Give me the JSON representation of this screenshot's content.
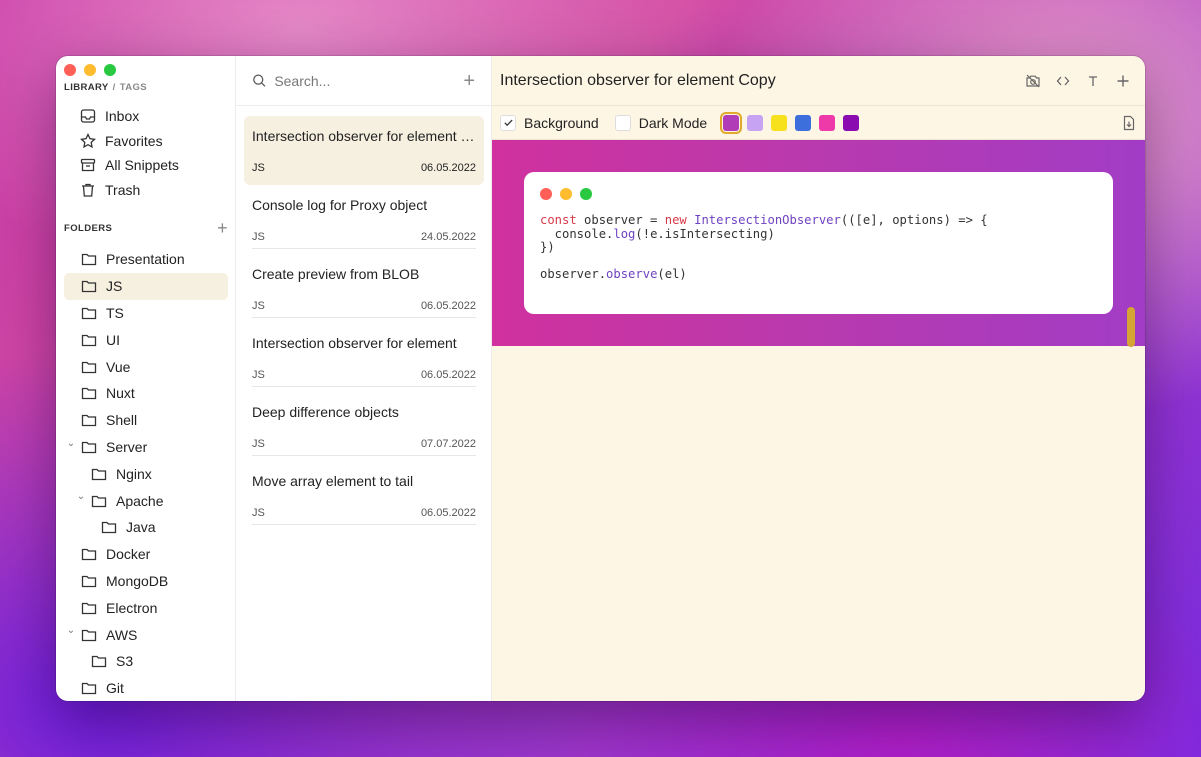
{
  "sidebar": {
    "tabs": {
      "library": "LIBRARY",
      "separator": "/",
      "tags": "TAGS"
    },
    "library_items": [
      {
        "label": "Inbox",
        "icon": "inbox-icon"
      },
      {
        "label": "Favorites",
        "icon": "star-icon"
      },
      {
        "label": "All Snippets",
        "icon": "archive-icon"
      },
      {
        "label": "Trash",
        "icon": "trash-icon"
      }
    ],
    "folders_label": "FOLDERS",
    "folders": [
      {
        "label": "Presentation",
        "depth": 0
      },
      {
        "label": "JS",
        "depth": 0,
        "active": true
      },
      {
        "label": "TS",
        "depth": 0
      },
      {
        "label": "UI",
        "depth": 0
      },
      {
        "label": "Vue",
        "depth": 0
      },
      {
        "label": "Nuxt",
        "depth": 0
      },
      {
        "label": "Shell",
        "depth": 0
      },
      {
        "label": "Server",
        "depth": 0,
        "expanded": true
      },
      {
        "label": "Nginx",
        "depth": 1
      },
      {
        "label": "Apache",
        "depth": 1,
        "expanded": true
      },
      {
        "label": "Java",
        "depth": 2
      },
      {
        "label": "Docker",
        "depth": 0
      },
      {
        "label": "MongoDB",
        "depth": 0
      },
      {
        "label": "Electron",
        "depth": 0
      },
      {
        "label": "AWS",
        "depth": 0,
        "expanded": true
      },
      {
        "label": "S3",
        "depth": 1
      },
      {
        "label": "Git",
        "depth": 0
      }
    ]
  },
  "search": {
    "placeholder": "Search..."
  },
  "snippets": [
    {
      "title": "Intersection observer for element Copy",
      "lang": "JS",
      "date": "06.05.2022",
      "active": true
    },
    {
      "title": "Console log for Proxy object",
      "lang": "JS",
      "date": "24.05.2022"
    },
    {
      "title": "Create preview from BLOB",
      "lang": "JS",
      "date": "06.05.2022"
    },
    {
      "title": "Intersection observer for element",
      "lang": "JS",
      "date": "06.05.2022"
    },
    {
      "title": "Deep difference objects",
      "lang": "JS",
      "date": "07.07.2022"
    },
    {
      "title": "Move array element to tail",
      "lang": "JS",
      "date": "06.05.2022"
    }
  ],
  "editor": {
    "title": "Intersection observer for element Copy",
    "options": {
      "background_label": "Background",
      "background_checked": true,
      "dark_mode_label": "Dark Mode",
      "dark_mode_checked": false
    },
    "swatches": [
      "#b03cb8",
      "#c6a4f3",
      "#f7e11c",
      "#3d6fdc",
      "#ee3aa8",
      "#8a0cb0"
    ],
    "selected_swatch": 0,
    "code": {
      "line1": [
        "const",
        " observer = ",
        "new",
        " ",
        "IntersectionObserver",
        "(([e], options) => {"
      ],
      "line2": [
        "  console.",
        "log",
        "(!e.isIntersecting)"
      ],
      "line3": "})",
      "line5": [
        "observer.",
        "observe",
        "(el)"
      ]
    }
  },
  "colors": {
    "traffic_red": "#ff5f57",
    "traffic_yellow": "#febc2e",
    "traffic_green": "#28c840",
    "accent": "#d4a534"
  }
}
